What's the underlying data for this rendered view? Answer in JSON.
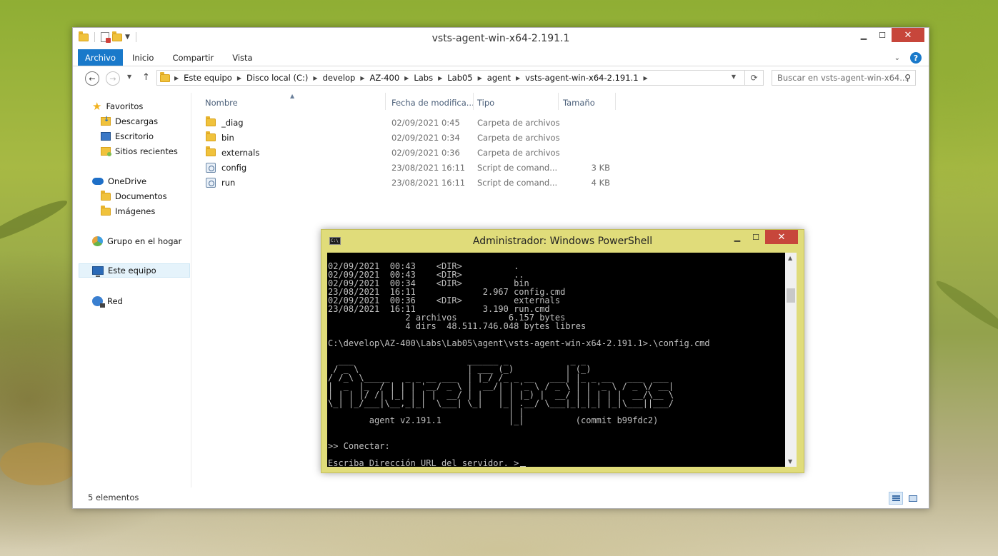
{
  "explorer": {
    "title": "vsts-agent-win-x64-2.191.1",
    "ribbon_tabs": [
      "Archivo",
      "Inicio",
      "Compartir",
      "Vista"
    ],
    "breadcrumb": [
      "Este equipo",
      "Disco local (C:)",
      "develop",
      "AZ-400",
      "Labs",
      "Lab05",
      "agent",
      "vsts-agent-win-x64-2.191.1"
    ],
    "search_placeholder": "Buscar en vsts-agent-win-x64...",
    "nav": {
      "favorites": "Favoritos",
      "downloads": "Descargas",
      "desktop": "Escritorio",
      "recent": "Sitios recientes",
      "onedrive": "OneDrive",
      "documents": "Documentos",
      "images": "Imágenes",
      "homegroup": "Grupo en el hogar",
      "this_pc": "Este equipo",
      "network": "Red"
    },
    "columns": {
      "name": "Nombre",
      "date": "Fecha de modifica...",
      "type": "Tipo",
      "size": "Tamaño"
    },
    "files": [
      {
        "name": "_diag",
        "date": "02/09/2021 0:45",
        "type": "Carpeta de archivos",
        "size": "",
        "icon": "folder-icon"
      },
      {
        "name": "bin",
        "date": "02/09/2021 0:34",
        "type": "Carpeta de archivos",
        "size": "",
        "icon": "folder-icon"
      },
      {
        "name": "externals",
        "date": "02/09/2021 0:36",
        "type": "Carpeta de archivos",
        "size": "",
        "icon": "folder-icon"
      },
      {
        "name": "config",
        "date": "23/08/2021 16:11",
        "type": "Script de comand...",
        "size": "3 KB",
        "icon": "script-icon"
      },
      {
        "name": "run",
        "date": "23/08/2021 16:11",
        "type": "Script de comand...",
        "size": "4 KB",
        "icon": "script-icon"
      }
    ],
    "status": "5 elementos"
  },
  "powershell": {
    "title": "Administrador: Windows PowerShell",
    "console_lines": [
      "02/09/2021  00:43    <DIR>          .",
      "02/09/2021  00:43    <DIR>          ..",
      "02/09/2021  00:34    <DIR>          bin",
      "23/08/2021  16:11             2.967 config.cmd",
      "02/09/2021  00:36    <DIR>          externals",
      "23/08/2021  16:11             3.190 run.cmd",
      "               2 archivos          6.157 bytes",
      "               4 dirs  48.511.746.048 bytes libres",
      "",
      "C:\\develop\\AZ-400\\Labs\\Lab05\\agent\\vsts-agent-win-x64-2.191.1>.\\config.cmd",
      "",
      "  ___                      ______ _            _ _",
      " / _ \\                     | ___ (_)          | (_)",
      "/ /_\\ \\_____   _ _ __ ___  | |_/ /_ _ __   ___| |_ _ __   ___  ___",
      "|  _  |_  / | | | '__/ _ \\ |  __/| | '_ \\ / _ \\ | | '_ \\ / _ \\/ __|",
      "| | | |/ /| |_| | | |  __/ | |   | | |_) |  __/ | | | | |  __/\\__ \\",
      "\\_| |_/___|\\__,_|_|  \\___| \\_|   |_| .__/ \\___|_|_|_| |_|\\___||___/",
      "                                   | |",
      "        agent v2.191.1             |_|          (commit b99fdc2)",
      "",
      "",
      ">> Conectar:",
      "",
      "Escriba Dirección URL del servidor. >"
    ]
  }
}
